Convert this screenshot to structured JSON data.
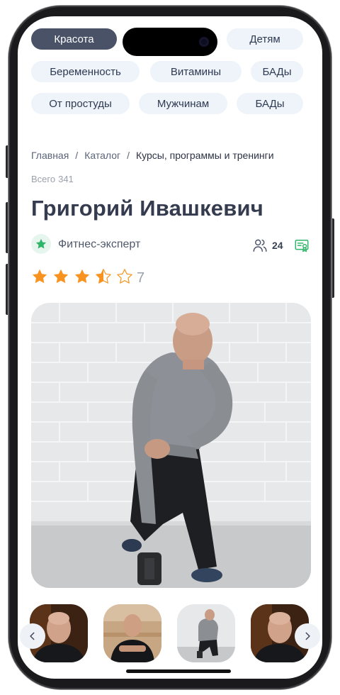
{
  "chips": {
    "row1": [
      {
        "label": "Красота",
        "active": true
      },
      {
        "label": "Детям",
        "active": false
      }
    ],
    "row2": [
      {
        "label": "Беременность"
      },
      {
        "label": "Витамины"
      },
      {
        "label": "БАДы"
      }
    ],
    "row3": [
      {
        "label": "От простуды"
      },
      {
        "label": "Мужчинам"
      },
      {
        "label": "БАДы"
      }
    ]
  },
  "breadcrumb": {
    "items": [
      "Главная",
      "Каталог",
      "Курсы, программы и тренинги"
    ],
    "separator": "/"
  },
  "total": {
    "label": "Всего",
    "value": "341"
  },
  "expert": {
    "name": "Григорий Ивашкевич",
    "role": "Фитнес-эксперт",
    "students_count": "24",
    "rating": 3.5,
    "rating_max": 5,
    "reviews_count": "7"
  },
  "icons": {
    "role": "star-badge-icon",
    "students": "users-icon",
    "certificate": "certificate-icon",
    "prev": "chevron-left-icon",
    "next": "chevron-right-icon"
  },
  "colors": {
    "accent": "#f7931e",
    "chip_active": "#4a5268",
    "chip_bg": "#eef4fa",
    "role_green": "#2fb56a",
    "text_dark": "#363c50"
  }
}
